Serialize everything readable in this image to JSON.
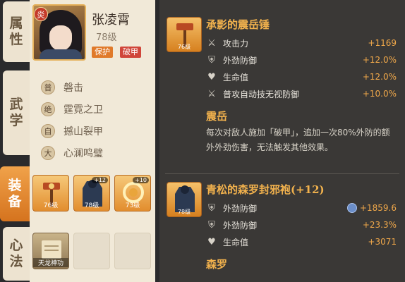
{
  "tabs": [
    {
      "label": "属性",
      "chars": [
        "属",
        "性"
      ],
      "active": false
    },
    {
      "label": "武学",
      "chars": [
        "武",
        "学"
      ],
      "active": false
    },
    {
      "label": "装备",
      "chars": [
        "装",
        "备"
      ],
      "active": true
    },
    {
      "label": "心法",
      "chars": [
        "心",
        "法"
      ],
      "active": false
    }
  ],
  "character": {
    "element_badge": "炎",
    "name": "张凌霄",
    "level": "78级",
    "tags": [
      "保护",
      "破甲"
    ]
  },
  "skills": [
    {
      "badge": "普",
      "name": "磐击"
    },
    {
      "badge": "绝",
      "name": "霆霓之卫"
    },
    {
      "badge": "自",
      "name": "撼山裂甲"
    },
    {
      "badge": "大",
      "name": "心澜鸣璧"
    }
  ],
  "equipment": [
    {
      "icon": "hammer-icon",
      "level": "76级",
      "plus": ""
    },
    {
      "icon": "robe-icon",
      "level": "78级",
      "plus": "+12"
    },
    {
      "icon": "ring-icon",
      "level": "73级",
      "plus": "+10"
    }
  ],
  "xinfa": {
    "slot_name": "天龙神功"
  },
  "detail": {
    "item1": {
      "name": "承影的震岳锤",
      "level": "76级",
      "stats": [
        {
          "icon": "sword-icon",
          "label": "攻击力",
          "value": "+1169"
        },
        {
          "icon": "shield-icon",
          "label": "外劲防御",
          "value": "+12.0%"
        },
        {
          "icon": "heart-icon",
          "label": "生命值",
          "value": "+12.0%"
        },
        {
          "icon": "sword-icon",
          "label": "普攻自动技无视防御",
          "value": "+10.0%"
        }
      ],
      "effect_title": "震岳",
      "effect_desc": "每次对敌人施加「破甲」，追加一次80%外防的额外外劲伤害，无法触发其他效果。"
    },
    "item2": {
      "name": "青松的森罗封邪袍(+12)",
      "level": "78级",
      "stats": [
        {
          "icon": "shield-icon",
          "label": "外劲防御",
          "value": "+1859.6"
        },
        {
          "icon": "shield-icon",
          "label": "外劲防御",
          "value": "+23.3%"
        },
        {
          "icon": "heart-icon",
          "label": "生命值",
          "value": "+3071"
        }
      ],
      "effect_title": "森罗"
    }
  }
}
